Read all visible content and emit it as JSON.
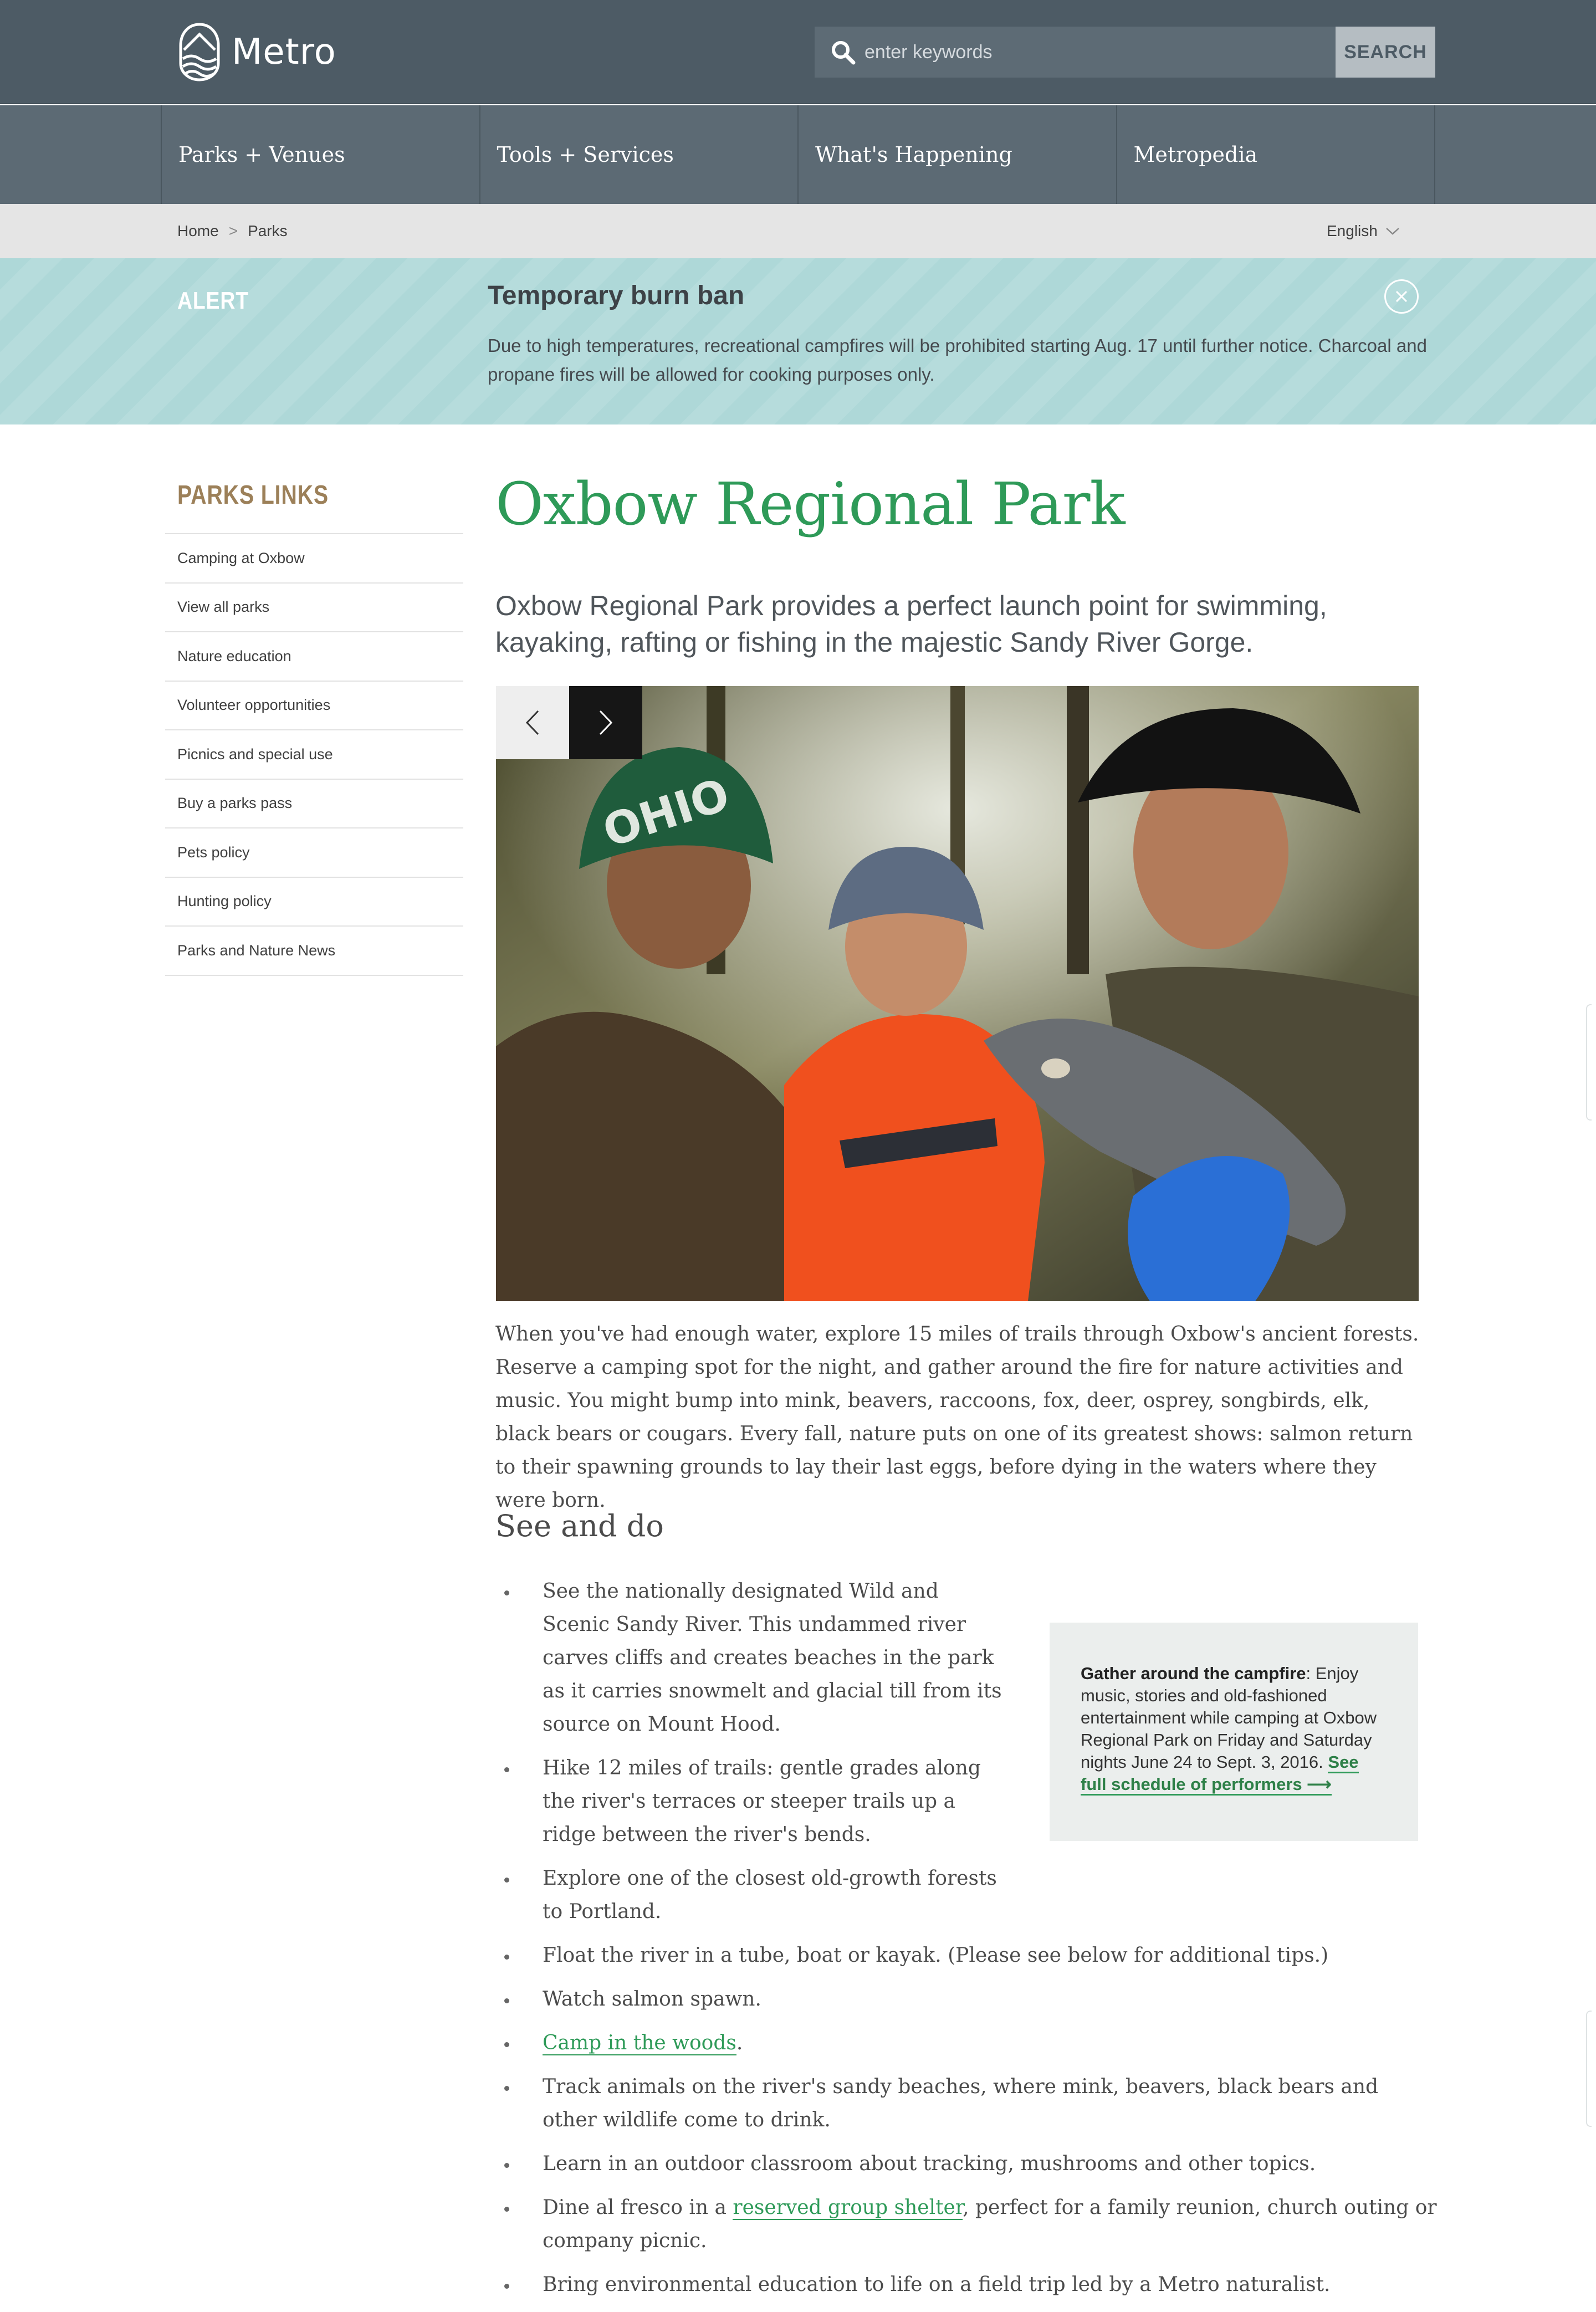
{
  "header": {
    "logo_text": "Metro",
    "search_placeholder": "enter keywords",
    "search_button": "SEARCH",
    "search_icon": "search-icon"
  },
  "nav": {
    "items": [
      "Parks + Venues",
      "Tools + Services",
      "What's Happening",
      "Metropedia"
    ]
  },
  "breadcrumb": {
    "items": [
      "Home",
      "Parks"
    ],
    "separator": ">",
    "language": "English"
  },
  "alert": {
    "label": "ALERT",
    "title": "Temporary burn ban",
    "body": "Due to high temperatures, recreational campfires will be prohibited starting Aug. 17 until further notice. Charcoal and propane fires will be allowed for cooking purposes only."
  },
  "sidebar": {
    "title": "PARKS LINKS",
    "items": [
      "Camping at Oxbow",
      "View all parks",
      "Nature education",
      "Volunteer opportunities",
      "Picnics and special use",
      "Buy a parks pass",
      "Pets policy",
      "Hunting policy",
      "Parks and Nature News"
    ]
  },
  "main": {
    "title": "Oxbow Regional Park",
    "lead": "Oxbow Regional Park provides a perfect launch point for swimming, kayaking, rafting or fishing in the majestic Sandy River Gorge.",
    "body": "When you've had enough water, explore 15 miles of trails through Oxbow's ancient forests. Reserve a camping spot for the night, and gather around the fire for nature activities and music. You might bump into mink, beavers, raccoons, fox, deer, osprey, songbirds, elk, black bears or cougars. Every fall, nature puts on one of its greatest shows: salmon return to their spawning grounds to lay their last eggs, before dying in the waters where they were born.",
    "section_heading": "See and do",
    "bullets": {
      "b1": "See the nationally designated Wild and Scenic Sandy River. This undammed river carves cliffs and creates beaches in the park as it carries snowmelt and glacial till from its source on Mount Hood.",
      "b2": "Hike 12 miles of trails: gentle grades along the river's terraces or steeper trails up a ridge between the river's bends.",
      "b3": "Explore one of the closest old-growth forests to Portland.",
      "b4": "Float the river in a tube, boat or kayak. (Please see below for additional tips.)",
      "b5": "Watch salmon spawn.",
      "b6_link": "Camp in the woods",
      "b6_after": ".",
      "b7": "Track animals on the river's sandy beaches, where mink, beavers, black bears and other wildlife come to drink.",
      "b8": "Learn in an outdoor classroom about tracking, mushrooms and other topics.",
      "b9_before": "Dine al fresco in a ",
      "b9_link": "reserved group shelter",
      "b9_after": ", perfect for a family reunion, church outing or company picnic.",
      "b10": "Bring environmental education to life on a field trip led by a Metro naturalist."
    }
  },
  "callout": {
    "lead": "Gather around the campfire",
    "text": ": Enjoy music, stories and old-fashioned entertainment while camping at Oxbow Regional Park on Friday and Saturday nights June 24 to Sept. 3, 2016. ",
    "link": "See full schedule of performers ⟶"
  },
  "carousel": {
    "prev_icon": "chevron-left-icon",
    "next_icon": "chevron-right-icon"
  },
  "colors": {
    "header_bg": "#4d5b65",
    "nav_bg": "#5c6a74",
    "alert_bg": "#aed8d8",
    "accent_green": "#2e9a58",
    "sidebar_title": "#9c8059"
  }
}
